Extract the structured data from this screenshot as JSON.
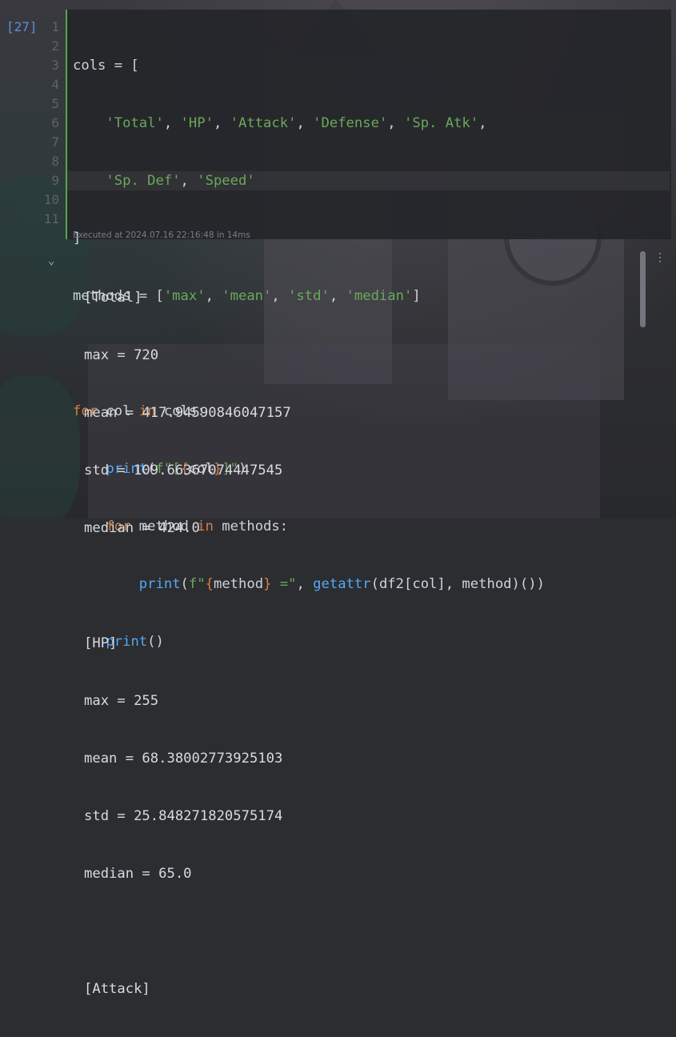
{
  "cell": {
    "execution_count": "[27]",
    "line_numbers": [
      "1",
      "2",
      "3",
      "4",
      "5",
      "6",
      "7",
      "8",
      "9",
      "10",
      "11"
    ],
    "executed_info": "Executed at 2024.07.16 22:16:48 in 14ms",
    "code": {
      "l1": {
        "a": "cols = ["
      },
      "l2": {
        "s1": "'Total'",
        "c1": ", ",
        "s2": "'HP'",
        "c2": ", ",
        "s3": "'Attack'",
        "c3": ", ",
        "s4": "'Defense'",
        "c4": ", ",
        "s5": "'Sp. Atk'",
        "c5": ","
      },
      "l3": {
        "s1": "'Sp. Def'",
        "c1": ", ",
        "s2": "'Speed'"
      },
      "l4": {
        "a": "]"
      },
      "l5": {
        "a": "methods = [",
        "s1": "'max'",
        "c1": ", ",
        "s2": "'mean'",
        "c2": ", ",
        "s3": "'std'",
        "c3": ", ",
        "s4": "'median'",
        "b": "]"
      },
      "l7": {
        "k1": "for",
        "a": " col ",
        "k2": "in",
        "b": " cols:"
      },
      "l8": {
        "f": "print",
        "p": "(",
        "s1": "f\"[",
        "b1": "{",
        "v": "col",
        "b2": "}",
        "s2": "]\"",
        "e": ")"
      },
      "l9": {
        "k1": "for",
        "a": " method ",
        "k2": "in",
        "b": " methods:"
      },
      "l10": {
        "f1": "print",
        "p": "(",
        "s1": "f\"",
        "b1": "{",
        "v": "method",
        "b2": "}",
        "s2": " =\"",
        "c": ", ",
        "f2": "getattr",
        "e": "(df2[col], method)())"
      },
      "l11": {
        "f": "print",
        "e": "()"
      }
    }
  },
  "output": {
    "lines": [
      "[Total]",
      "max = 720",
      "mean = 417.94590846047157",
      "std = 109.66367074447545",
      "median = 424.0",
      "",
      "[HP]",
      "max = 255",
      "mean = 68.38002773925103",
      "std = 25.848271820575174",
      "median = 65.0",
      "",
      "[Attack]"
    ],
    "collapse_icon": "⌄",
    "more_icon": "⋮"
  }
}
